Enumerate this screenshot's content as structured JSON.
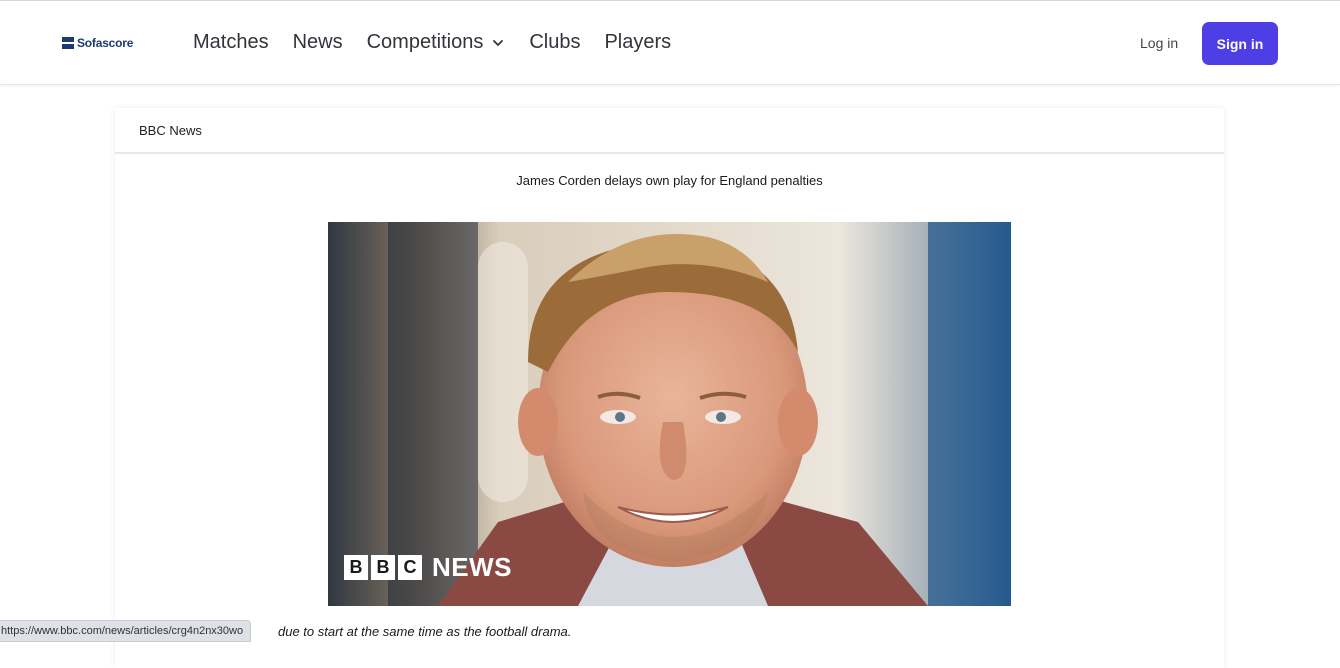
{
  "header": {
    "logo_text": "Sofascore",
    "nav": [
      {
        "label": "Matches"
      },
      {
        "label": "News"
      },
      {
        "label": "Competitions"
      },
      {
        "label": "Clubs"
      },
      {
        "label": "Players"
      }
    ],
    "login_label": "Log in",
    "signin_label": "Sign in"
  },
  "article": {
    "source": "BBC News",
    "headline": "James Corden delays own play for England penalties",
    "image_brand": {
      "letters": [
        "B",
        "B",
        "C"
      ],
      "word": "NEWS"
    },
    "caption_partial": "due to start at the same time as the football drama."
  },
  "status_bar": {
    "url": "https://www.bbc.com/news/articles/crg4n2nx30wo"
  },
  "colors": {
    "accent": "#4d3ee6",
    "logo": "#1b3a72"
  }
}
